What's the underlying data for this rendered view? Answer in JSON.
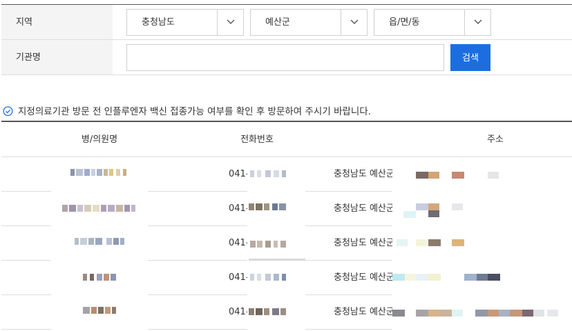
{
  "filter": {
    "region_label": "지역",
    "org_label": "기관명",
    "province": "충청남도",
    "county": "예산군",
    "town": "읍/면/동",
    "org_value": "",
    "search_label": "검색"
  },
  "notice": "지정의료기관 방문 전 인플루엔자 백신 접종가능 여부를 확인 후 방문하여 주시기 바랍니다.",
  "table": {
    "headers": [
      "병/의원명",
      "전화번호",
      "주소"
    ],
    "rows": [
      {
        "phone_prefix": "041-",
        "address": "충청남도 예산군"
      },
      {
        "phone_prefix": "041-",
        "address": "충청남도 예산군"
      },
      {
        "phone_prefix": "041-",
        "address": "충청남도 예산군"
      },
      {
        "phone_prefix": "041-",
        "address": "충청남도 예산군"
      },
      {
        "phone_prefix": "041-",
        "address": "충청남도 예산군"
      }
    ]
  },
  "colors": {
    "accent": "#1c6ee0",
    "label_bg": "#f4f4f4",
    "border": "#dddddd"
  }
}
